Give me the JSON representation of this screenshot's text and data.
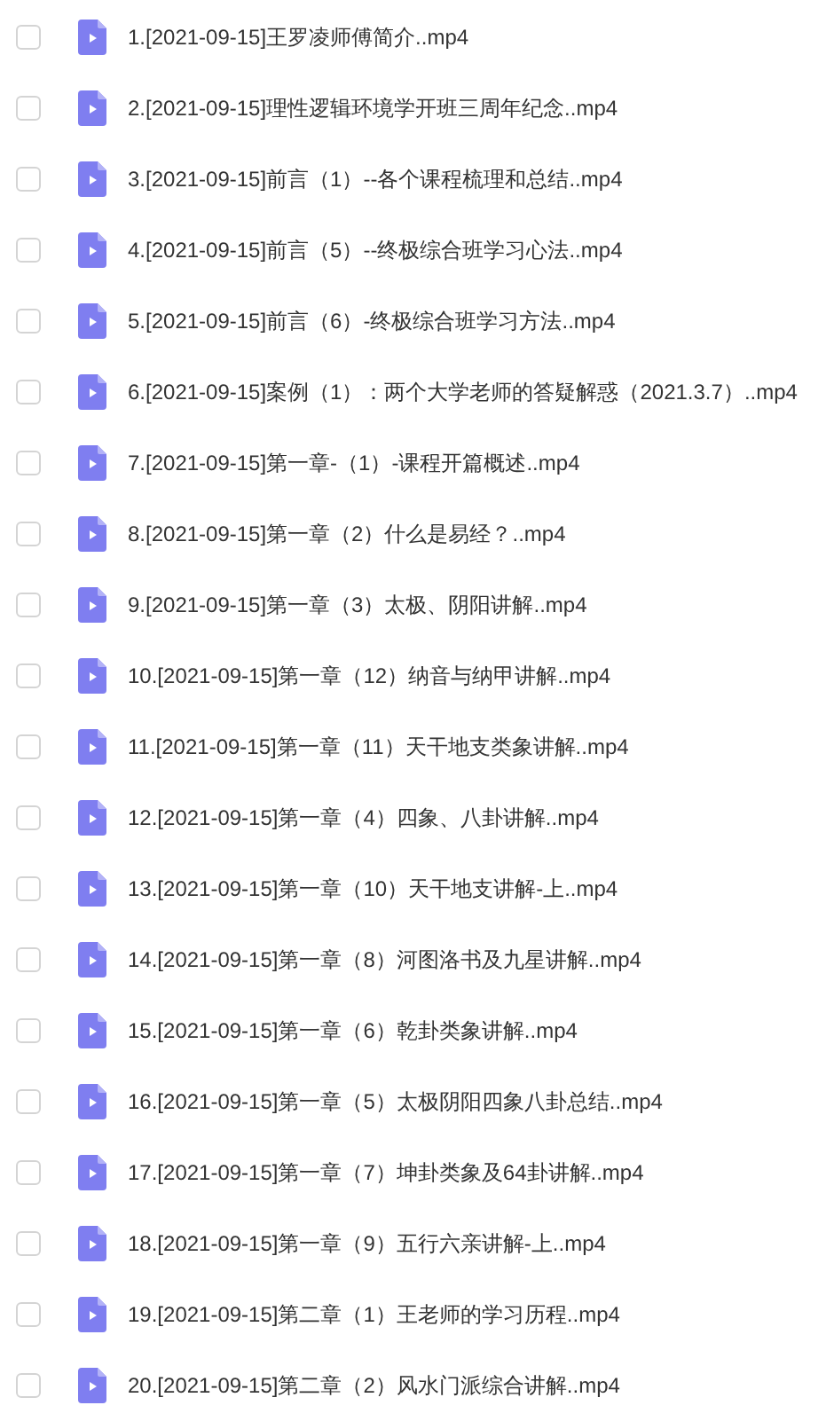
{
  "files": [
    {
      "name": "1.[2021-09-15]王罗凌师傅简介..mp4",
      "checked": false
    },
    {
      "name": "2.[2021-09-15]理性逻辑环境学开班三周年纪念..mp4",
      "checked": false
    },
    {
      "name": "3.[2021-09-15]前言（1）--各个课程梳理和总结..mp4",
      "checked": false
    },
    {
      "name": "4.[2021-09-15]前言（5）--终极综合班学习心法..mp4",
      "checked": false
    },
    {
      "name": "5.[2021-09-15]前言（6）-终极综合班学习方法..mp4",
      "checked": false
    },
    {
      "name": "6.[2021-09-15]案例（1）：两个大学老师的答疑解惑（2021.3.7）..mp4",
      "checked": false
    },
    {
      "name": "7.[2021-09-15]第一章-（1）-课程开篇概述..mp4",
      "checked": false
    },
    {
      "name": "8.[2021-09-15]第一章（2）什么是易经？..mp4",
      "checked": false
    },
    {
      "name": "9.[2021-09-15]第一章（3）太极、阴阳讲解..mp4",
      "checked": false
    },
    {
      "name": "10.[2021-09-15]第一章（12）纳音与纳甲讲解..mp4",
      "checked": false
    },
    {
      "name": "11.[2021-09-15]第一章（11）天干地支类象讲解..mp4",
      "checked": false
    },
    {
      "name": "12.[2021-09-15]第一章（4）四象、八卦讲解..mp4",
      "checked": false
    },
    {
      "name": "13.[2021-09-15]第一章（10）天干地支讲解-上..mp4",
      "checked": false
    },
    {
      "name": "14.[2021-09-15]第一章（8）河图洛书及九星讲解..mp4",
      "checked": false
    },
    {
      "name": "15.[2021-09-15]第一章（6）乾卦类象讲解..mp4",
      "checked": false
    },
    {
      "name": "16.[2021-09-15]第一章（5）太极阴阳四象八卦总结..mp4",
      "checked": false
    },
    {
      "name": "17.[2021-09-15]第一章（7）坤卦类象及64卦讲解..mp4",
      "checked": false
    },
    {
      "name": "18.[2021-09-15]第一章（9）五行六亲讲解-上..mp4",
      "checked": false
    },
    {
      "name": "19.[2021-09-15]第二章（1）王老师的学习历程..mp4",
      "checked": false
    },
    {
      "name": "20.[2021-09-15]第二章（2）风水门派综合讲解..mp4",
      "checked": false
    }
  ]
}
